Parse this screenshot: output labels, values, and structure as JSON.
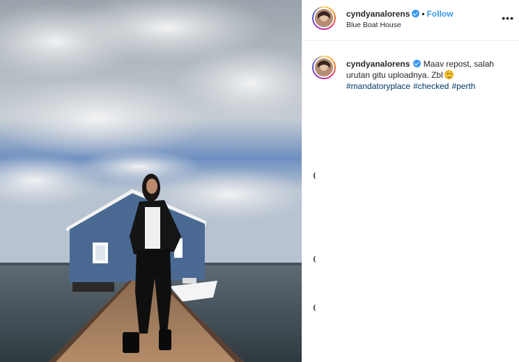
{
  "header": {
    "username": "cyndyanalorens",
    "separator": "•",
    "follow_label": "Follow",
    "location": "Blue Boat House",
    "more_icon": "more-options-icon",
    "more_glyph": "•••"
  },
  "comment": {
    "username": "cyndyanalorens",
    "text": "Maav repost, salah urutan gitu uploadnya. Zbl",
    "emoji_icon": "winking-face-icon",
    "hashtags": [
      "#mandatoryplace",
      "#checked",
      "#perth"
    ]
  },
  "colors": {
    "link_blue": "#3897f0",
    "hashtag_blue": "#00376b",
    "text": "#262626",
    "boathouse_blue": "#4a6a94"
  }
}
